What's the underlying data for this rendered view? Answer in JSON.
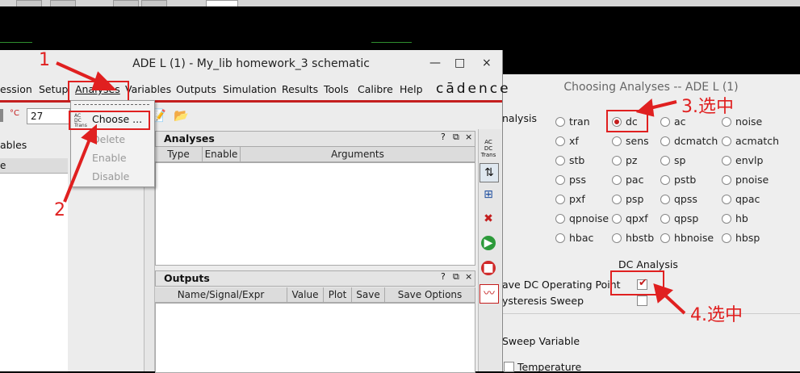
{
  "choose_dialog": {
    "title": "Choosing Analyses -- ADE L (1)",
    "analysis_label": "nalysis",
    "analyses": [
      [
        "tran",
        "dc",
        "ac",
        "noise"
      ],
      [
        "xf",
        "sens",
        "dcmatch",
        "acmatch"
      ],
      [
        "stb",
        "pz",
        "sp",
        "envlp"
      ],
      [
        "pss",
        "pac",
        "pstb",
        "pnoise"
      ],
      [
        "pxf",
        "psp",
        "qpss",
        "qpac"
      ],
      [
        "qpnoise",
        "qpxf",
        "qpsp",
        "hb"
      ],
      [
        "hbac",
        "hbstb",
        "hbnoise",
        "hbsp"
      ]
    ],
    "selected": "dc",
    "dc_section_title": "DC Analysis",
    "save_dc_label": "ave DC Operating Point",
    "save_dc_checked": true,
    "hysteresis_label": "ysteresis Sweep",
    "hysteresis_checked": false,
    "sweep_variable_label": "Sweep Variable",
    "temperature_label": "Temperature"
  },
  "ade_window": {
    "title": "ADE L (1) - My_lib homework_3 schematic",
    "controls": [
      "—",
      "□",
      "×"
    ],
    "menu": [
      "ession",
      "Setup",
      "Analyses",
      "Variables",
      "Outputs",
      "Simulation",
      "Results",
      "Tools",
      "Calibre",
      "Help"
    ],
    "brand": "cādence",
    "temp_unit": "°C",
    "temperature_value": "27",
    "left_panel_label": "ables",
    "left_col_label": "e",
    "analyses_panel": {
      "title": "Analyses",
      "columns": [
        "Type",
        "Enable",
        "Arguments"
      ],
      "icons": [
        "?",
        "⧉",
        "×"
      ]
    },
    "outputs_panel": {
      "title": "Outputs",
      "columns": [
        "Name/Signal/Expr",
        "Value",
        "Plot",
        "Save",
        "Save Options"
      ],
      "icons": [
        "?",
        "⧉",
        "×"
      ]
    },
    "dropdown": {
      "items": [
        "Choose ...",
        "Delete",
        "Enable",
        "Disable"
      ]
    }
  },
  "annotations": [
    "1",
    "2",
    "3.选中",
    "4.选中"
  ]
}
